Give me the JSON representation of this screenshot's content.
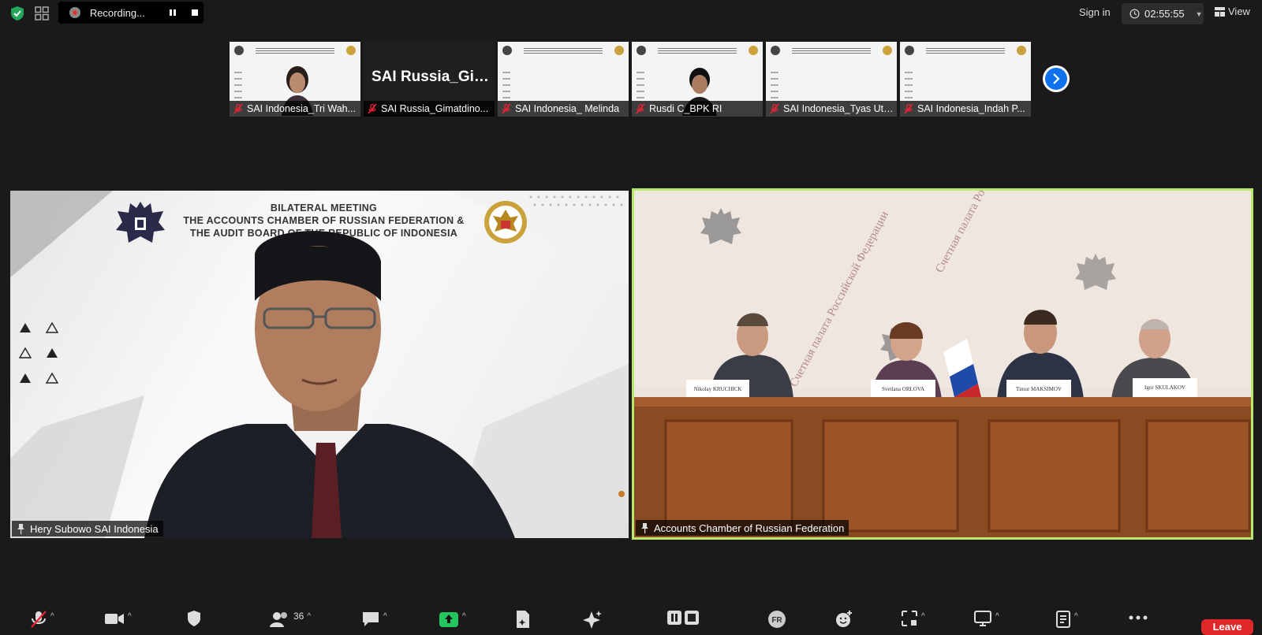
{
  "topbar": {
    "recording_label": "Recording...",
    "sign_in": "Sign in",
    "timer": "02:55:55",
    "view_label": "View"
  },
  "thumbnails": [
    {
      "name": "SAI Indonesia_Tri Wah...",
      "muted": true,
      "content": "slide-person"
    },
    {
      "name": "SAI Russia_Gimatdino...",
      "muted": true,
      "content": "name-tile",
      "tile_text": "SAI  Russia_Gim..."
    },
    {
      "name": "SAI Indonesia_ Melinda",
      "muted": true,
      "content": "slide"
    },
    {
      "name": "Rusdi C_BPK RI",
      "muted": true,
      "content": "slide-person"
    },
    {
      "name": "SAI Indonesia_Tyas Uta...",
      "muted": true,
      "content": "slide"
    },
    {
      "name": "SAI Indonesia_Indah P...",
      "muted": true,
      "content": "slide"
    }
  ],
  "main_videos": {
    "left": {
      "name": "Hery Subowo SAI Indonesia",
      "slide_title": [
        "BILATERAL MEETING",
        "THE ACCOUNTS CHAMBER OF RUSSIAN FEDERATION &",
        "THE AUDIT BOARD OF THE REPUBLIC OF INDONESIA"
      ]
    },
    "right": {
      "name": "Accounts Chamber of Russian Federation",
      "nameplates": [
        "Nikolay KRUCHICK",
        "Svetlana ORLOVA",
        "Timur MAKSIMOV",
        "Igor SKULAKOV"
      ],
      "wall_text": "Счетная палата Российской Федерации",
      "active_speaker_color": "#b9e86a"
    }
  },
  "toolbar": {
    "participants_count": "36",
    "language_badge": "FR",
    "leave_label": "Leave"
  },
  "colors": {
    "background": "#1a1a1a",
    "accent_blue": "#0e72ed",
    "leave_red": "#e02828",
    "share_green": "#22c55e"
  }
}
